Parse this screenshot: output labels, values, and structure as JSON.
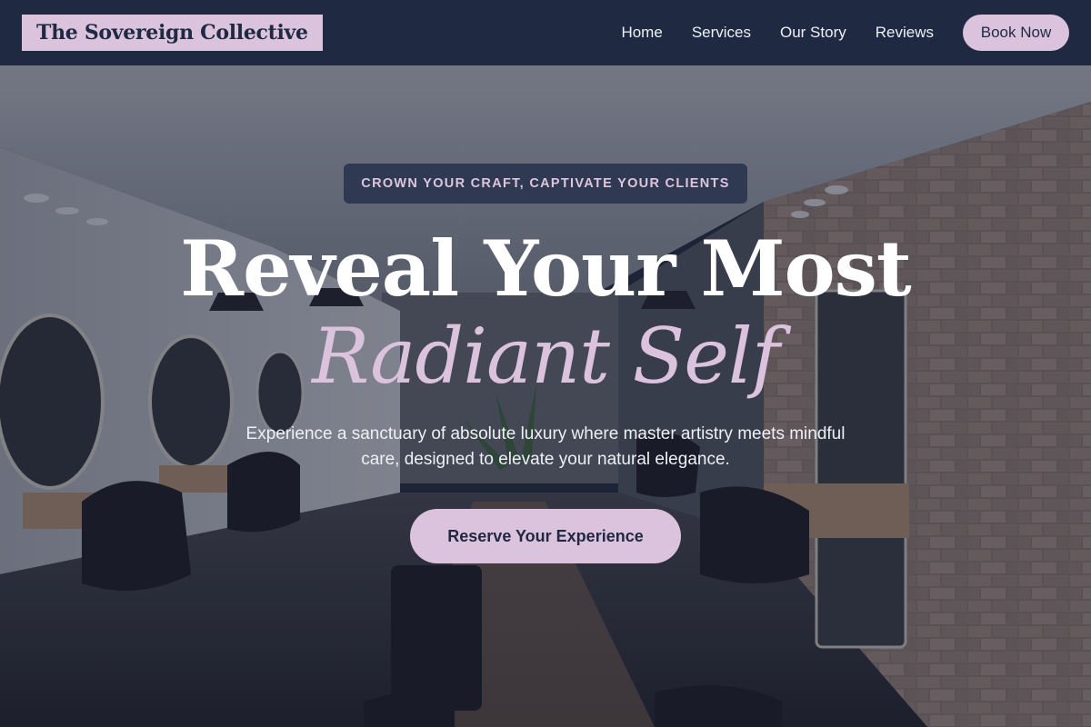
{
  "brand": {
    "name": "The Sovereign Collective"
  },
  "nav": {
    "links": [
      "Home",
      "Services",
      "Our Story",
      "Reviews"
    ],
    "cta_label": "Book Now"
  },
  "hero": {
    "eyebrow": "CROWN YOUR CRAFT, CAPTIVATE YOUR CLIENTS",
    "headline": "Reveal Your Most",
    "headline_accent": "Radiant Self",
    "subtitle": "Experience a sanctuary of absolute luxury where master artistry meets mindful care, designed to elevate your natural elegance.",
    "cta_label": "Reserve Your Experience"
  },
  "colors": {
    "navy": "#1f2a42",
    "lilac": "#dcc3dd",
    "white": "#ffffff"
  }
}
